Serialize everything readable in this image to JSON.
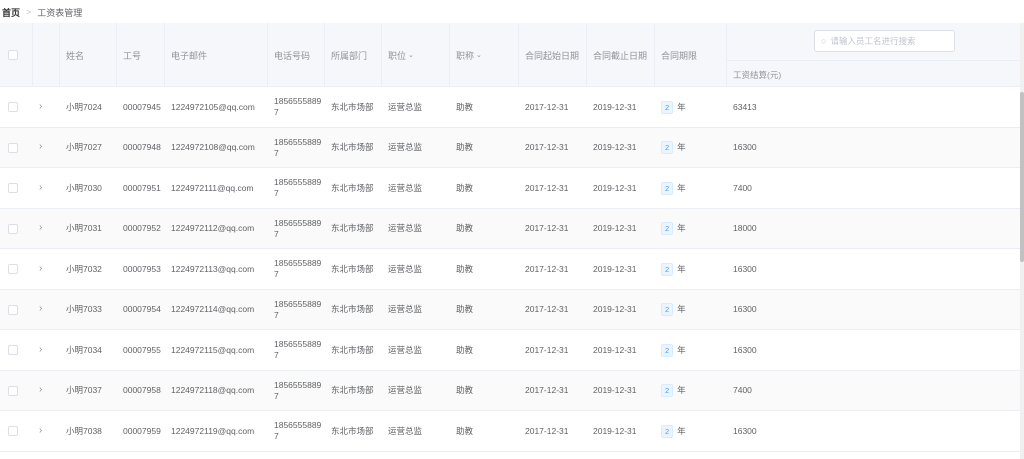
{
  "breadcrumb": {
    "home": "首页",
    "separator": ">",
    "current": "工资表管理"
  },
  "search": {
    "placeholder": "请输入员工名进行搜索"
  },
  "columns": {
    "name": "姓名",
    "id": "工号",
    "email": "电子邮件",
    "phone": "电话号码",
    "dept": "所属部门",
    "position": "职位",
    "title": "职称",
    "start": "合同起始日期",
    "end": "合同截止日期",
    "term": "合同期限",
    "salary": "工资结算(元)"
  },
  "icons": {
    "filter": "chevron-down-icon",
    "expand": "chevron-right-icon",
    "search": "search-icon"
  },
  "colors": {
    "tag_text": "#409eff",
    "tag_bg": "#ecf5ff",
    "header_bg": "#f5f7fa"
  },
  "rows": [
    {
      "name": "小明7024",
      "id": "00007945",
      "email": "1224972105@qq.com",
      "phone": "18565558897",
      "dept": "东北市场部",
      "position": "运营总监",
      "title": "助教",
      "start": "2017-12-31",
      "end": "2019-12-31",
      "term_num": "2",
      "term_unit": "年",
      "salary": "63413"
    },
    {
      "name": "小明7027",
      "id": "00007948",
      "email": "1224972108@qq.com",
      "phone": "18565558897",
      "dept": "东北市场部",
      "position": "运营总监",
      "title": "助教",
      "start": "2017-12-31",
      "end": "2019-12-31",
      "term_num": "2",
      "term_unit": "年",
      "salary": "16300"
    },
    {
      "name": "小明7030",
      "id": "00007951",
      "email": "1224972111@qq.com",
      "phone": "18565558897",
      "dept": "东北市场部",
      "position": "运营总监",
      "title": "助教",
      "start": "2017-12-31",
      "end": "2019-12-31",
      "term_num": "2",
      "term_unit": "年",
      "salary": "7400"
    },
    {
      "name": "小明7031",
      "id": "00007952",
      "email": "1224972112@qq.com",
      "phone": "18565558897",
      "dept": "东北市场部",
      "position": "运营总监",
      "title": "助教",
      "start": "2017-12-31",
      "end": "2019-12-31",
      "term_num": "2",
      "term_unit": "年",
      "salary": "18000"
    },
    {
      "name": "小明7032",
      "id": "00007953",
      "email": "1224972113@qq.com",
      "phone": "18565558897",
      "dept": "东北市场部",
      "position": "运营总监",
      "title": "助教",
      "start": "2017-12-31",
      "end": "2019-12-31",
      "term_num": "2",
      "term_unit": "年",
      "salary": "16300"
    },
    {
      "name": "小明7033",
      "id": "00007954",
      "email": "1224972114@qq.com",
      "phone": "18565558897",
      "dept": "东北市场部",
      "position": "运营总监",
      "title": "助教",
      "start": "2017-12-31",
      "end": "2019-12-31",
      "term_num": "2",
      "term_unit": "年",
      "salary": "16300"
    },
    {
      "name": "小明7034",
      "id": "00007955",
      "email": "1224972115@qq.com",
      "phone": "18565558897",
      "dept": "东北市场部",
      "position": "运营总监",
      "title": "助教",
      "start": "2017-12-31",
      "end": "2019-12-31",
      "term_num": "2",
      "term_unit": "年",
      "salary": "16300"
    },
    {
      "name": "小明7037",
      "id": "00007958",
      "email": "1224972118@qq.com",
      "phone": "18565558897",
      "dept": "东北市场部",
      "position": "运营总监",
      "title": "助教",
      "start": "2017-12-31",
      "end": "2019-12-31",
      "term_num": "2",
      "term_unit": "年",
      "salary": "7400"
    },
    {
      "name": "小明7038",
      "id": "00007959",
      "email": "1224972119@qq.com",
      "phone": "18565558897",
      "dept": "东北市场部",
      "position": "运营总监",
      "title": "助教",
      "start": "2017-12-31",
      "end": "2019-12-31",
      "term_num": "2",
      "term_unit": "年",
      "salary": "16300"
    }
  ]
}
